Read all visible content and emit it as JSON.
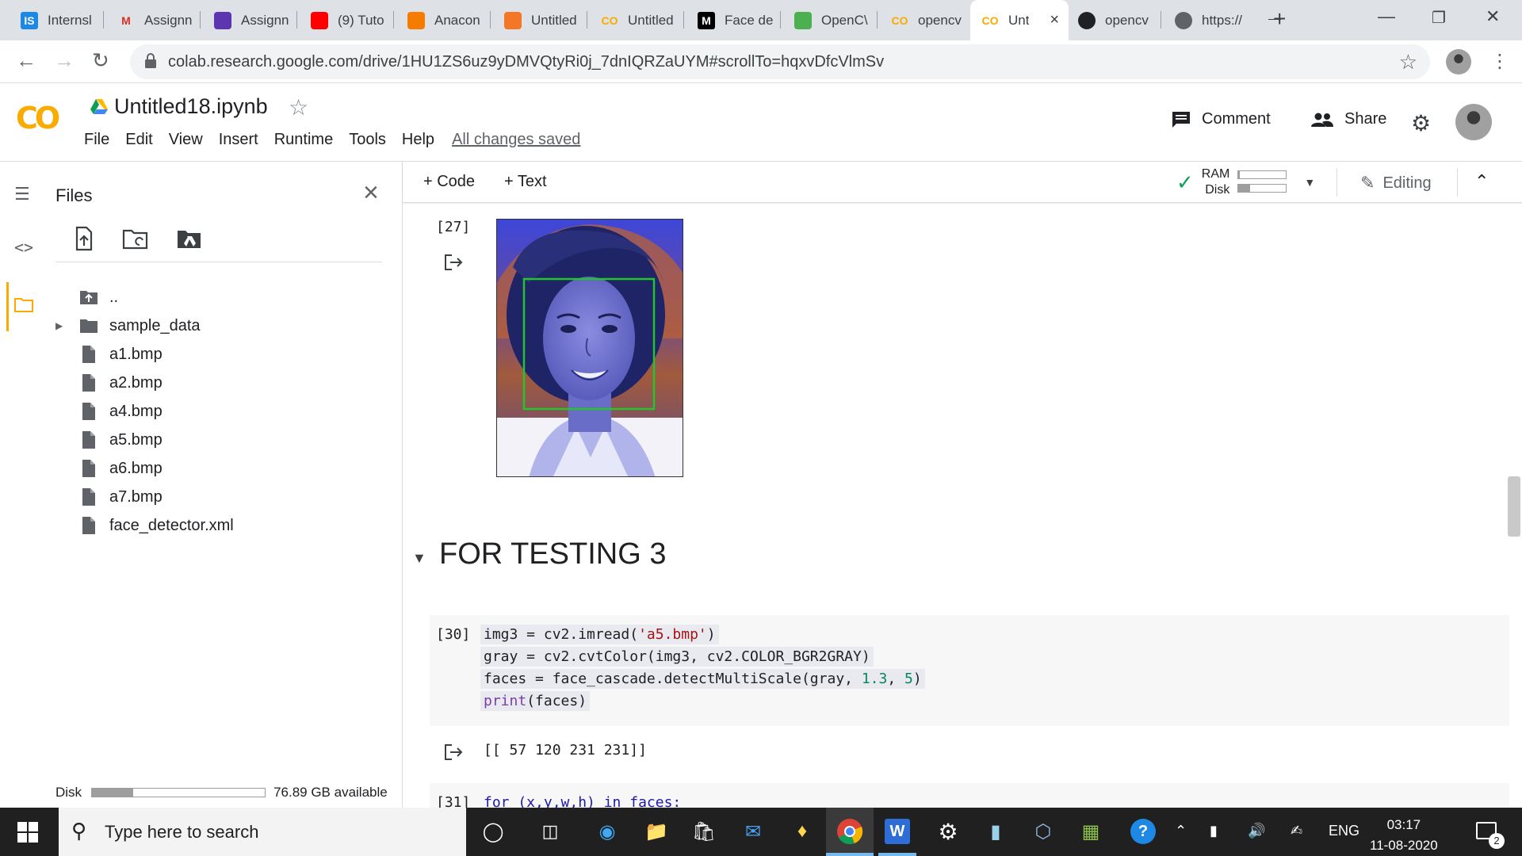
{
  "browser": {
    "tabs": [
      {
        "title": "Internsl",
        "favicon": "IS",
        "favicon_color": "#1e88e5"
      },
      {
        "title": "Assignn",
        "favicon": "M",
        "favicon_color": "#d93025"
      },
      {
        "title": "Assignn",
        "favicon": "list-icon",
        "favicon_color": "#5e35b1"
      },
      {
        "title": "(9) Tuto",
        "favicon": "youtube-icon",
        "favicon_color": "#ff0000"
      },
      {
        "title": "Anacon",
        "favicon": "anaconda-icon",
        "favicon_color": "#f57c00"
      },
      {
        "title": "Untitled",
        "favicon": "jupyter-icon",
        "favicon_color": "#f37726"
      },
      {
        "title": "Untitled",
        "favicon": "CO",
        "favicon_color": "#f9ab00"
      },
      {
        "title": "Face de",
        "favicon": "M",
        "favicon_color": "#000000"
      },
      {
        "title": "OpenC\\",
        "favicon": "opencv-icon",
        "favicon_color": "#4caf50"
      },
      {
        "title": "opencv",
        "favicon": "CO",
        "favicon_color": "#f9ab00"
      },
      {
        "title": "Unt",
        "favicon": "CO",
        "favicon_color": "#f9ab00"
      },
      {
        "title": "opencv",
        "favicon": "github-icon",
        "favicon_color": "#202124"
      },
      {
        "title": "https://",
        "favicon": "globe-icon",
        "favicon_color": "#5f6368"
      }
    ],
    "url": "colab.research.google.com/drive/1HU1ZS6uz9yDMVQtyRi0j_7dnIQRZaUYM#scrollTo=hqxvDfcVlmSv"
  },
  "colab": {
    "logo": "CO",
    "notebook_title": "Untitled18.ipynb",
    "menu": [
      "File",
      "Edit",
      "View",
      "Insert",
      "Runtime",
      "Tools",
      "Help"
    ],
    "save_status": "All changes saved",
    "comment_label": "Comment",
    "share_label": "Share"
  },
  "files_panel": {
    "title": "Files",
    "items": [
      {
        "name": "..",
        "type": "parent"
      },
      {
        "name": "sample_data",
        "type": "folder"
      },
      {
        "name": "a1.bmp",
        "type": "file"
      },
      {
        "name": "a2.bmp",
        "type": "file"
      },
      {
        "name": "a4.bmp",
        "type": "file"
      },
      {
        "name": "a5.bmp",
        "type": "file"
      },
      {
        "name": "a6.bmp",
        "type": "file"
      },
      {
        "name": "a7.bmp",
        "type": "file"
      },
      {
        "name": "face_detector.xml",
        "type": "file"
      }
    ],
    "disk_label": "Disk",
    "disk_available": "76.89 GB available",
    "disk_used_fraction": 0.24
  },
  "notebook_toolbar": {
    "code_label": "+ Code",
    "text_label": "+ Text",
    "ram_label": "RAM",
    "disk_label": "Disk",
    "ram_fraction": 0.03,
    "disk_fraction": 0.24,
    "editing_label": "Editing"
  },
  "cells": {
    "image_output_count": "[27]",
    "section_title": "FOR TESTING 3",
    "code_count": "[30]",
    "code_output": "[[ 57 120 231 231]]",
    "next_count": "[31]",
    "next_code_fragment": "for (x,y,w,h) in faces:"
  },
  "taskbar": {
    "search_placeholder": "Type here to search",
    "language": "ENG",
    "time": "03:17",
    "date": "11-08-2020",
    "notification_count": "2"
  }
}
